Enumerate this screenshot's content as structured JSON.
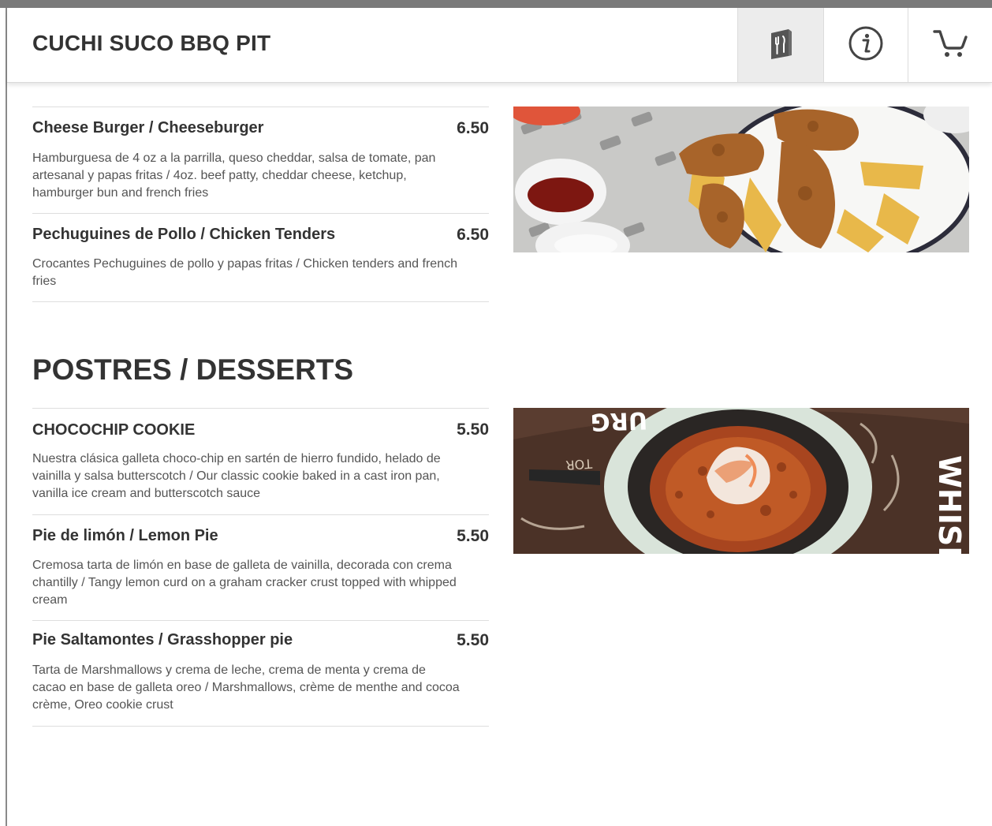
{
  "header": {
    "title": "CUCHI SUCO BBQ PIT",
    "buttons": [
      {
        "icon": "menu-icon",
        "active": true
      },
      {
        "icon": "info-icon",
        "active": false
      },
      {
        "icon": "cart-icon",
        "active": false
      }
    ]
  },
  "sections": [
    {
      "title": "",
      "items": [
        {
          "name": "Cheese Burger / Cheeseburger",
          "price": "6.50",
          "description": "Hamburguesa de 4 oz a la parrilla, queso cheddar, salsa de tomate, pan artesanal y papas fritas / 4oz. beef patty, cheddar cheese, ketchup, hamburger bun and french fries"
        },
        {
          "name": "Pechuguines de Pollo / Chicken Tenders",
          "price": "6.50",
          "description": "Crocantes Pechuguines de pollo y papas fritas / Chicken tenders and french fries"
        }
      ],
      "image": "chicken-tenders-photo"
    },
    {
      "title": "POSTRES / DESSERTS",
      "items": [
        {
          "name": "CHOCOCHIP COOKIE",
          "price": "5.50",
          "description": "Nuestra clásica galleta choco-chip en sartén de hierro fundido, helado de vainilla y salsa butterscotch / Our classic cookie baked in a cast iron pan, vanilla ice cream and butterscotch sauce"
        },
        {
          "name": "Pie de limón / Lemon Pie",
          "price": "5.50",
          "description": "Cremosa tarta de limón en base de galleta de vainilla, decorada con crema chantilly / Tangy lemon curd on a graham cracker crust topped with whipped cream"
        },
        {
          "name": "Pie Saltamontes / Grasshopper pie",
          "price": "5.50",
          "description": "Tarta de Marshmallows y crema de leche, crema de menta y crema de cacao en base de galleta oreo / Marshmallows, crème de menthe and cocoa crème, Oreo cookie crust"
        }
      ],
      "image": "cookie-skillet-photo"
    }
  ]
}
